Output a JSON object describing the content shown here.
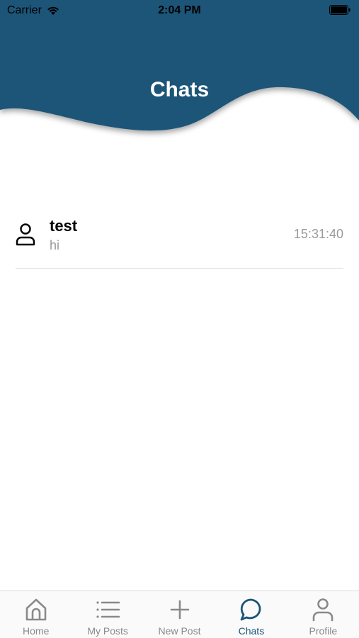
{
  "status_bar": {
    "carrier": "Carrier",
    "time": "2:04 PM"
  },
  "header": {
    "title": "Chats",
    "color": "#1e5478"
  },
  "chats": [
    {
      "name": "test",
      "preview": "hi",
      "time": "15:31:40",
      "avatar_icon": "person-outline-icon"
    }
  ],
  "tab_bar": {
    "active_tab": "Chats",
    "accent_color": "#1b5478",
    "tabs": [
      {
        "label": "Home",
        "icon": "home-icon"
      },
      {
        "label": "My Posts",
        "icon": "list-icon"
      },
      {
        "label": "New Post",
        "icon": "plus-icon"
      },
      {
        "label": "Chats",
        "icon": "chat-bubble-icon"
      },
      {
        "label": "Profile",
        "icon": "person-icon"
      }
    ]
  }
}
